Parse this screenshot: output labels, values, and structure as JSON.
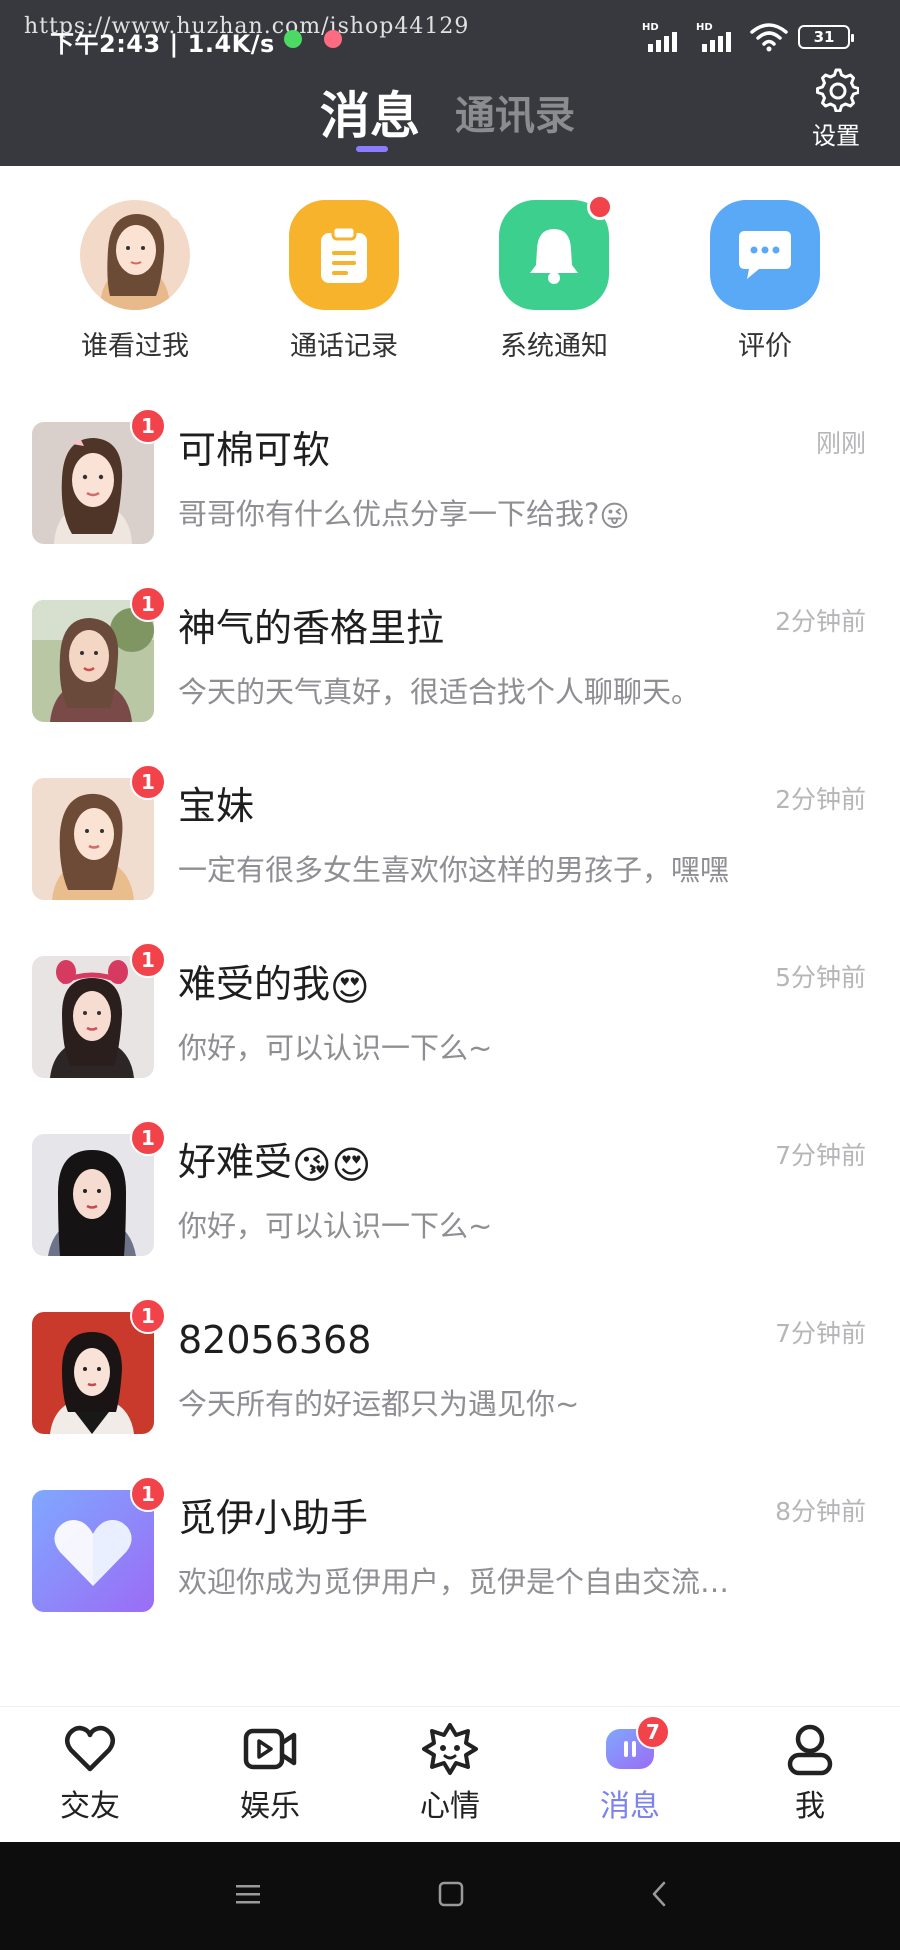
{
  "status_bar": {
    "time": "下午2:43 | 1.4K/s",
    "watermark": "https://www.huzhan.com/ishop44129",
    "signal1_label": "HD",
    "signal2_label": "HD",
    "battery": "31"
  },
  "header": {
    "tab_messages": "消息",
    "tab_contacts": "通讯录",
    "settings_label": "设置"
  },
  "quick_actions": [
    {
      "label": "谁看过我",
      "icon": "viewer-avatar",
      "dot": true
    },
    {
      "label": "通话记录",
      "icon": "clipboard-icon",
      "dot": false,
      "color": "#f7b32b"
    },
    {
      "label": "系统通知",
      "icon": "bell-icon",
      "dot": true,
      "color": "#3dcf8e"
    },
    {
      "label": "评价",
      "icon": "comment-icon",
      "dot": false,
      "color": "#5aa9f7"
    }
  ],
  "conversations": [
    {
      "name": "可棉可软",
      "time": "刚刚",
      "preview": "哥哥你有什么优点分享一下给我?",
      "preview_emoji": "😜",
      "unread": "1"
    },
    {
      "name": "神气的香格里拉",
      "time": "2分钟前",
      "preview": "今天的天气真好，很适合找个人聊聊天。",
      "unread": "1"
    },
    {
      "name": "宝妹",
      "time": "2分钟前",
      "preview": "一定有很多女生喜欢你这样的男孩子，嘿嘿",
      "unread": "1"
    },
    {
      "name": "难受的我",
      "name_emoji": "😍",
      "time": "5分钟前",
      "preview": "你好，可以认识一下么~",
      "unread": "1"
    },
    {
      "name": "好难受",
      "name_emoji": "😘😍",
      "time": "7分钟前",
      "preview": "你好，可以认识一下么~",
      "unread": "1"
    },
    {
      "name": "82056368",
      "time": "7分钟前",
      "preview": "今天所有的好运都只为遇见你~",
      "unread": "1"
    },
    {
      "name": "觅伊小助手",
      "time": "8分钟前",
      "preview": "欢迎你成为觅伊用户，觅伊是个自由交流…",
      "unread": "1"
    }
  ],
  "bottom_nav": [
    {
      "label": "交友",
      "icon": "heart-icon"
    },
    {
      "label": "娱乐",
      "icon": "video-icon"
    },
    {
      "label": "心情",
      "icon": "mood-icon"
    },
    {
      "label": "消息",
      "icon": "message-icon",
      "badge": "7",
      "active": true
    },
    {
      "label": "我",
      "icon": "person-icon"
    }
  ],
  "colors": {
    "header_bg": "#38393e",
    "accent": "#7b83f0",
    "badge_red": "#f2424a"
  }
}
